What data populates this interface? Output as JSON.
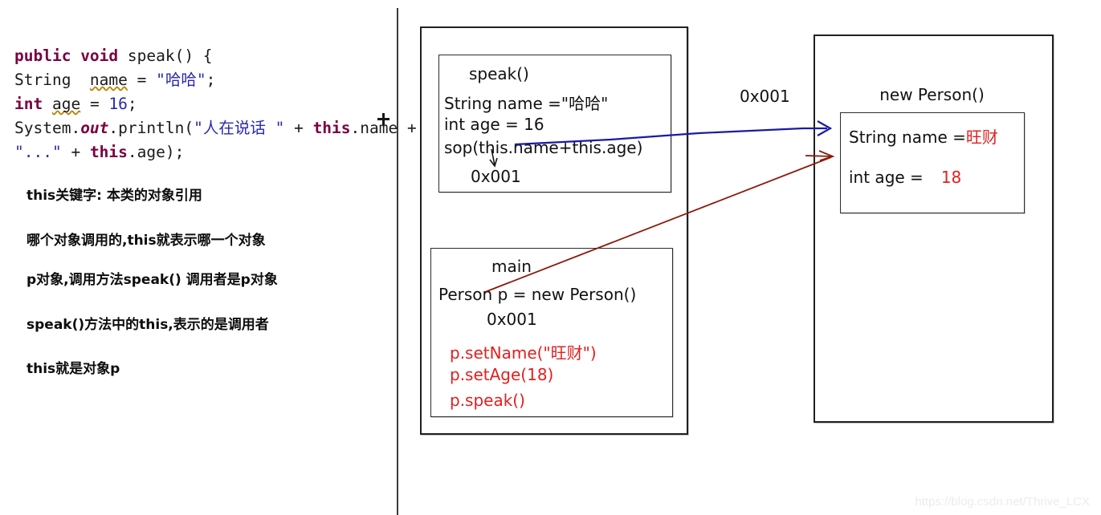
{
  "code": {
    "lines": [
      [
        {
          "t": "public ",
          "c": "kw"
        },
        {
          "t": "void ",
          "c": "kw"
        },
        {
          "t": "speak() {",
          "c": ""
        }
      ],
      [
        {
          "t": "String  ",
          "c": ""
        },
        {
          "t": "name",
          "c": "wavy"
        },
        {
          "t": " = ",
          "c": ""
        },
        {
          "t": "\"哈哈\"",
          "c": "str"
        },
        {
          "t": ";",
          "c": ""
        }
      ],
      [
        {
          "t": "int ",
          "c": "kw"
        },
        {
          "t": "age",
          "c": "wavy"
        },
        {
          "t": " = ",
          "c": ""
        },
        {
          "t": "16",
          "c": "cn"
        },
        {
          "t": ";",
          "c": ""
        }
      ],
      [
        {
          "t": "System.",
          "c": ""
        },
        {
          "t": "out",
          "c": "kwi"
        },
        {
          "t": ".println(",
          "c": ""
        },
        {
          "t": "\"人在说话 \"",
          "c": "str"
        },
        {
          "t": " + ",
          "c": ""
        },
        {
          "t": "this",
          "c": "kw"
        },
        {
          "t": ".name +",
          "c": ""
        }
      ],
      [
        {
          "t": "\"...\"",
          "c": "str"
        },
        {
          "t": " + ",
          "c": ""
        },
        {
          "t": "this",
          "c": "kw"
        },
        {
          "t": ".age);",
          "c": ""
        }
      ]
    ]
  },
  "notes": [
    "this关键字: 本类的对象引用",
    "哪个对象调用的,this就表示哪一个对象",
    "p对象,调用方法speak()  调用者是p对象",
    "speak()方法中的this,表示的是调用者",
    "this就是对象p"
  ],
  "speak_frame": {
    "title": "speak()",
    "line1": "String name =\"哈哈\"",
    "line2": "int age = 16",
    "line3": "sop(this.name+this.age)",
    "line4": "0x001"
  },
  "main_frame": {
    "title": "main",
    "line1": "Person p = new Person()",
    "line2": "0x001",
    "call1": "p.setName(\"旺财\")",
    "call2": "p.setAge(18)",
    "call3": "p.speak()"
  },
  "heap": {
    "title": "new Person()",
    "name_label": "String name =",
    "name_value": "旺财",
    "age_label": "int age =",
    "age_value": "18"
  },
  "address_label": "0x001",
  "watermark": "https://blog.csdn.net/Thrive_LCX",
  "colors": {
    "keyword": "#7a0040",
    "string": "#2a2ab0",
    "red": "#e02020",
    "blue_arrow": "#1a1aa8",
    "red_arrow": "#8b1a0a",
    "border": "#202020"
  }
}
